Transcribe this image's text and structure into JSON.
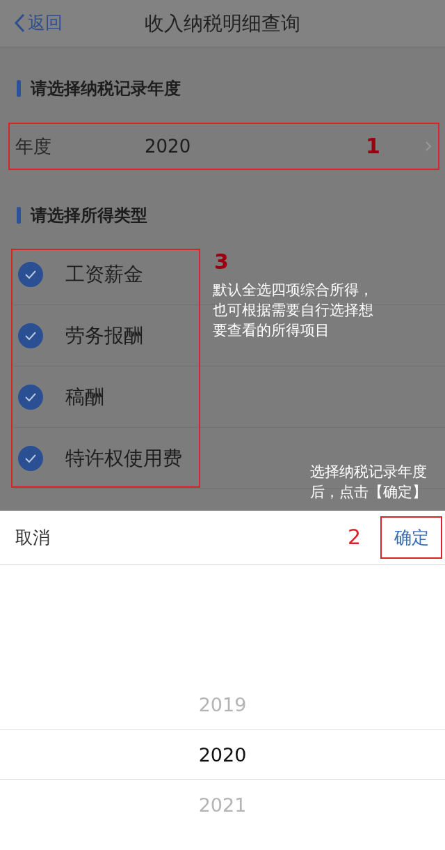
{
  "nav": {
    "back": "返回",
    "title": "收入纳税明细查询"
  },
  "year_section": {
    "heading": "请选择纳税记录年度",
    "label": "年度",
    "value": "2020",
    "marker": "1"
  },
  "income_section": {
    "heading": "请选择所得类型",
    "marker": "3",
    "note": "默认全选四项综合所得，也可根据需要自行选择想要查看的所得项目",
    "items": [
      {
        "label": "工资薪金",
        "checked": true
      },
      {
        "label": "劳务报酬",
        "checked": true
      },
      {
        "label": "稿酬",
        "checked": true
      },
      {
        "label": "特许权使用费",
        "checked": true
      }
    ]
  },
  "confirm_note": "选择纳税记录年度后，点击【确定】",
  "sheet": {
    "cancel": "取消",
    "marker": "2",
    "confirm": "确定",
    "options": [
      {
        "label": "2019",
        "selected": false
      },
      {
        "label": "2020",
        "selected": true
      },
      {
        "label": "2021",
        "selected": false
      }
    ]
  }
}
